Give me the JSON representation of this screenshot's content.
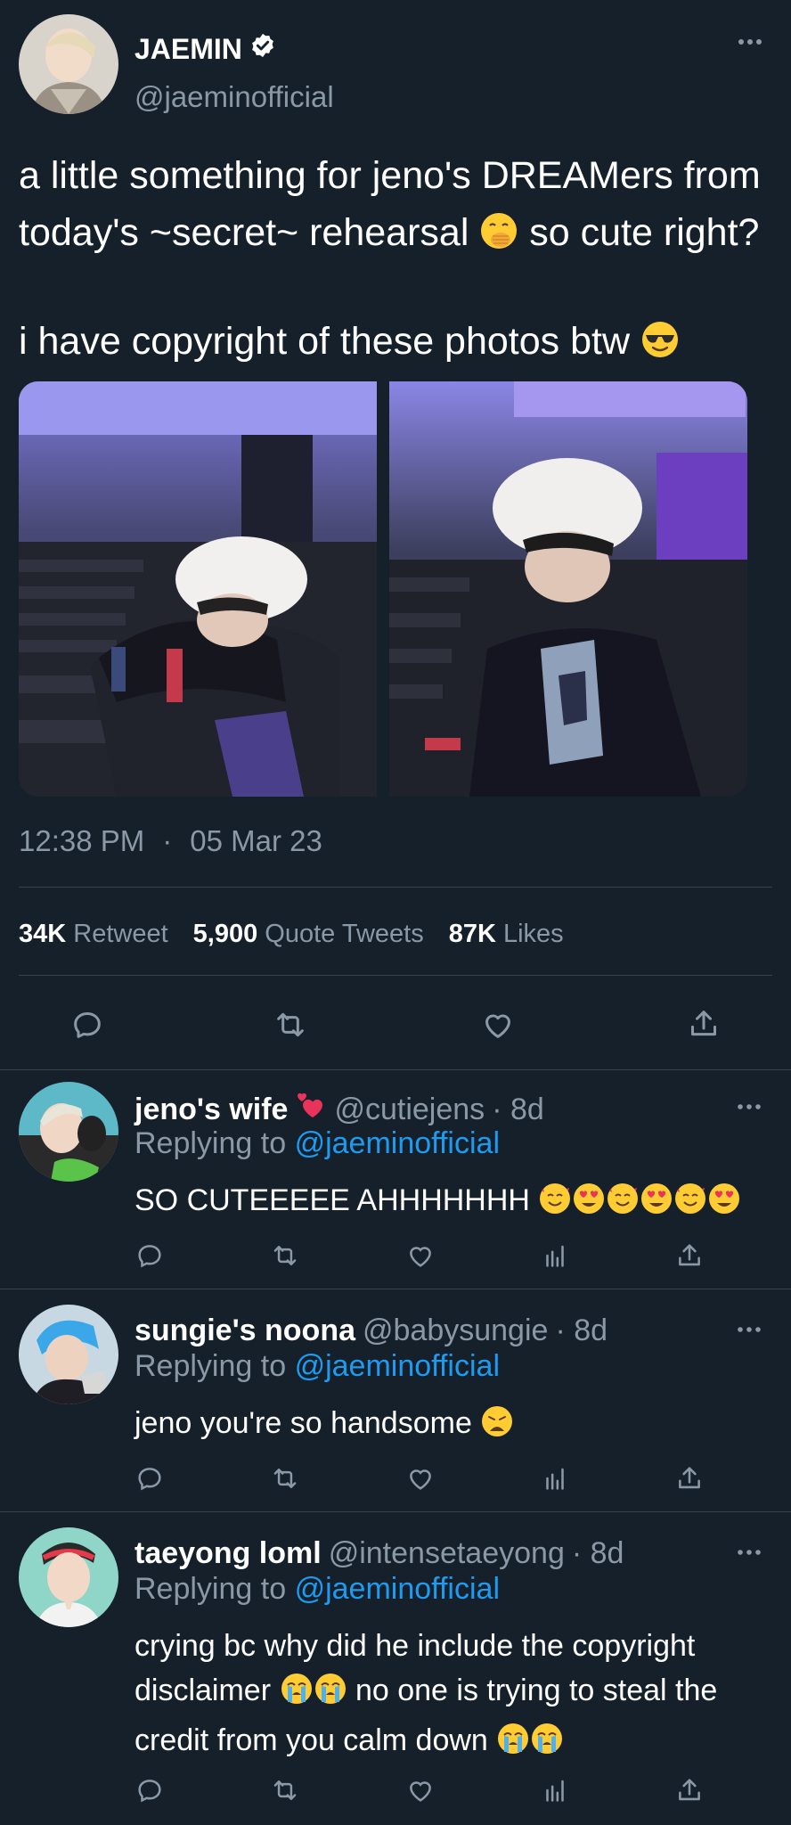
{
  "tweet": {
    "author_name": "JAEMIN",
    "handle": "@jaeminofficial",
    "text_line1": "a little something for jeno's DREAMers from today's ~secret~ rehearsal",
    "text_line1_end": "so cute right?",
    "text_line2": "i have copyright of these photos btw",
    "time": "12:38 PM",
    "separator": "·",
    "date": "05 Mar 23",
    "stats": {
      "retweets_value": "34K",
      "retweets_label": "Retweet",
      "quotes_value": "5,900",
      "quotes_label": "Quote Tweets",
      "likes_value": "87K",
      "likes_label": "Likes"
    }
  },
  "replies": [
    {
      "name": "jeno's wife",
      "handle": "@cutiejens",
      "age": "· 8d",
      "replying_prefix": "Replying to",
      "replying_to": "@jaeminofficial",
      "text": "SO CUTEEEEE AHHHHHHH"
    },
    {
      "name": "sungie's noona",
      "handle": "@babysungie",
      "age": "· 8d",
      "replying_prefix": "Replying to",
      "replying_to": "@jaeminofficial",
      "text": "jeno you're so handsome"
    },
    {
      "name": "taeyong loml",
      "handle": "@intensetaeyong",
      "age": "· 8d",
      "replying_prefix": "Replying to",
      "replying_to": "@jaeminofficial",
      "text_a": "crying bc why did he include the copyright disclaimer",
      "text_b": "no one is trying to steal the credit from you calm down"
    }
  ],
  "colors": {
    "background": "#15202b",
    "muted": "#8b98a5",
    "link": "#1d9bf0",
    "divider": "#38444d"
  }
}
